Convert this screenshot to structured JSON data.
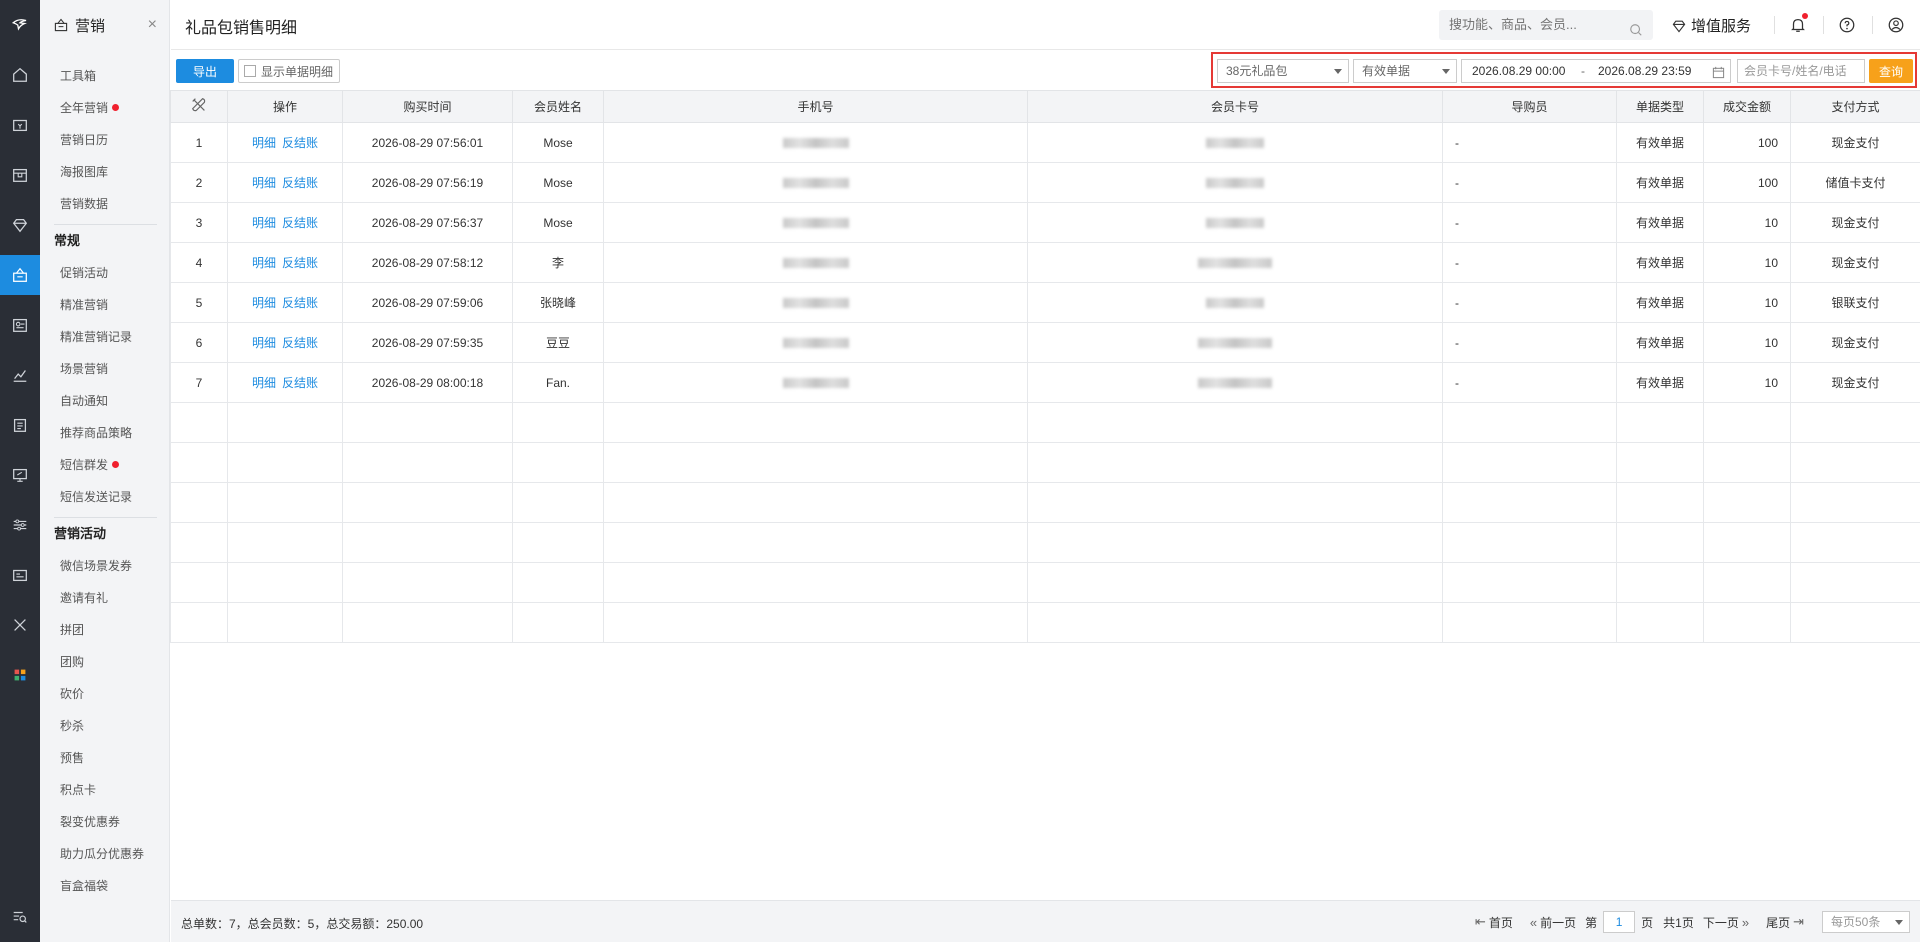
{
  "colors": {
    "accent": "#1d8ce0",
    "query_button": "#f7a11a",
    "highlight_border": "#e53935",
    "rail_bg": "#2a2e36",
    "notification_dot": "#f0202e"
  },
  "rail": {
    "icons": [
      "logo-icon",
      "home-icon",
      "wallet-icon",
      "store-icon",
      "diamond-icon",
      "marketing-icon",
      "member-card-icon",
      "chart-icon",
      "clipboard-icon",
      "monitor-icon",
      "sliders-icon",
      "id-card-icon",
      "tools-icon",
      "apps-icon",
      "search-list-icon"
    ]
  },
  "menu": {
    "title": "营销",
    "close": "×",
    "items_top": [
      {
        "label": "工具箱",
        "dot": false
      },
      {
        "label": "全年营销",
        "dot": true
      },
      {
        "label": "营销日历",
        "dot": false
      },
      {
        "label": "海报图库",
        "dot": false
      },
      {
        "label": "营销数据",
        "dot": false
      }
    ],
    "group1": "常规",
    "items_regular": [
      {
        "label": "促销活动",
        "dot": false
      },
      {
        "label": "精准营销",
        "dot": false
      },
      {
        "label": "精准营销记录",
        "dot": false
      },
      {
        "label": "场景营销",
        "dot": false
      },
      {
        "label": "自动通知",
        "dot": false
      },
      {
        "label": "推荐商品策略",
        "dot": false
      },
      {
        "label": "短信群发",
        "dot": true
      },
      {
        "label": "短信发送记录",
        "dot": false
      }
    ],
    "group2": "营销活动",
    "items_activity": [
      {
        "label": "微信场景发券"
      },
      {
        "label": "邀请有礼"
      },
      {
        "label": "拼团"
      },
      {
        "label": "团购"
      },
      {
        "label": "砍价"
      },
      {
        "label": "秒杀"
      },
      {
        "label": "预售"
      },
      {
        "label": "积点卡"
      },
      {
        "label": "裂变优惠券"
      },
      {
        "label": "助力瓜分优惠券"
      },
      {
        "label": "盲盒福袋"
      }
    ]
  },
  "header": {
    "title": "礼品包销售明细",
    "search_placeholder": "搜功能、商品、会员...",
    "value_added": "增值服务"
  },
  "toolbar": {
    "export": "导出",
    "show_detail": "显示单据明细",
    "package_select": "38元礼品包",
    "status_select": "有效单据",
    "date_start": "2026.08.29 00:00",
    "date_sep": "-",
    "date_end": "2026.08.29 23:59",
    "keyword_placeholder": "会员卡号/姓名/电话",
    "query": "查询"
  },
  "table": {
    "columns": [
      "操作",
      "购买时间",
      "会员姓名",
      "手机号",
      "会员卡号",
      "导购员",
      "单据类型",
      "成交金额",
      "支付方式"
    ],
    "op_detail": "明细",
    "op_reverse": "反结账",
    "rows": [
      {
        "no": "1",
        "time": "2026-08-29 07:56:01",
        "name": "Mose",
        "guide": "-",
        "type": "有效单据",
        "amount": "100",
        "pay": "现金支付"
      },
      {
        "no": "2",
        "time": "2026-08-29 07:56:19",
        "name": "Mose",
        "guide": "-",
        "type": "有效单据",
        "amount": "100",
        "pay": "储值卡支付"
      },
      {
        "no": "3",
        "time": "2026-08-29 07:56:37",
        "name": "Mose",
        "guide": "-",
        "type": "有效单据",
        "amount": "10",
        "pay": "现金支付"
      },
      {
        "no": "4",
        "time": "2026-08-29 07:58:12",
        "name": "李",
        "guide": "-",
        "type": "有效单据",
        "amount": "10",
        "pay": "现金支付"
      },
      {
        "no": "5",
        "time": "2026-08-29 07:59:06",
        "name": "张晓峰",
        "guide": "-",
        "type": "有效单据",
        "amount": "10",
        "pay": "银联支付"
      },
      {
        "no": "6",
        "time": "2026-08-29 07:59:35",
        "name": "豆豆",
        "guide": "-",
        "type": "有效单据",
        "amount": "10",
        "pay": "现金支付"
      },
      {
        "no": "7",
        "time": "2026-08-29 08:00:18",
        "name": "Fan.",
        "guide": "-",
        "type": "有效单据",
        "amount": "10",
        "pay": "现金支付"
      }
    ]
  },
  "footer": {
    "summary": "总单数：7，总会员数：5，总交易额：250.00",
    "first": "首页",
    "prev": "前一页",
    "page_label": "第",
    "page_value": "1",
    "page_unit": "页",
    "total_pages": "共1页",
    "next": "下一页",
    "last": "尾页",
    "per_page_placeholder": "每页50条"
  }
}
